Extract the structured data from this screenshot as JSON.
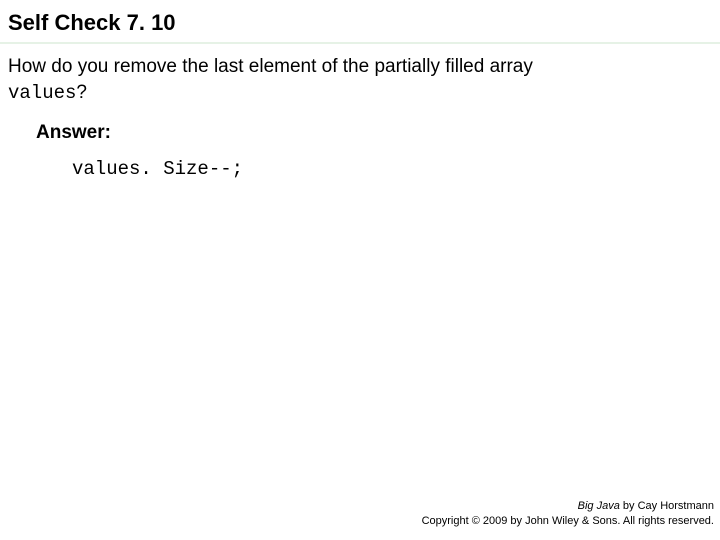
{
  "title": "Self Check 7. 10",
  "question": {
    "line1": "How do you remove the last element of the partially filled array",
    "codeword": "values",
    "qmark": "?"
  },
  "answer": {
    "label": "Answer:",
    "code": "values. Size--;"
  },
  "footer": {
    "book": "Big Java",
    "byline": " by Cay Horstmann",
    "copyright": "Copyright © 2009 by John Wiley & Sons. All rights reserved."
  }
}
